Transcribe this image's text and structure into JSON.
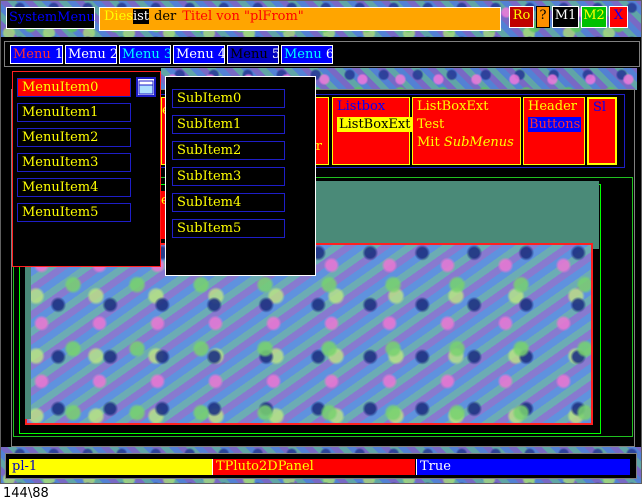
{
  "titlebar": {
    "system_menu": "SystemMenu",
    "title_a": "Dies",
    "title_b": "ist",
    "title_c": "der",
    "title_d": "Titel von \"plFrom\"",
    "btn_ro": "Ro",
    "btn_q": "?",
    "btn_m1": "M1",
    "btn_m2": "M2",
    "btn_x": "X"
  },
  "menubar": {
    "m1_a": "Menu",
    "m1_b": "1",
    "m2": "Menu 2",
    "m3": "Menu 3",
    "m4": "Menu 4",
    "m5_a": "Menu",
    "m5_b": "5",
    "m6_a": "Menu",
    "m6_b": "6"
  },
  "dropdown": {
    "items": [
      "MenuItem0",
      "MenuItem1",
      "MenuItem2",
      "MenuItem3",
      "MenuItem4",
      "MenuItem5"
    ]
  },
  "submenu": {
    "items": [
      "SubItem0",
      "SubItem1",
      "SubItem2",
      "SubItem3",
      "SubItem4",
      "SubItem5"
    ]
  },
  "toolbar_cells": {
    "partial_e": "e",
    "partial_r": "r",
    "listbox_title": "Listbox",
    "listbox_value": "ListBoxExt",
    "listboxext_line1": "ListBoxExt Test",
    "listboxext_line2a": "Mit ",
    "listboxext_line2b": "SubMenus",
    "header_title": "Header",
    "header_buttons": "Buttons",
    "sl": "Sl"
  },
  "statusbar": {
    "field1": "pl-1",
    "field2": "TPluto2DPanel",
    "field3": "True"
  },
  "coord_readout": "144\\88",
  "colors": {
    "accent_red": "#ff0000",
    "accent_yellow": "#ffff00",
    "accent_blue": "#0000ff",
    "orange": "#ffa500",
    "panel_teal": "#4a8a78"
  }
}
